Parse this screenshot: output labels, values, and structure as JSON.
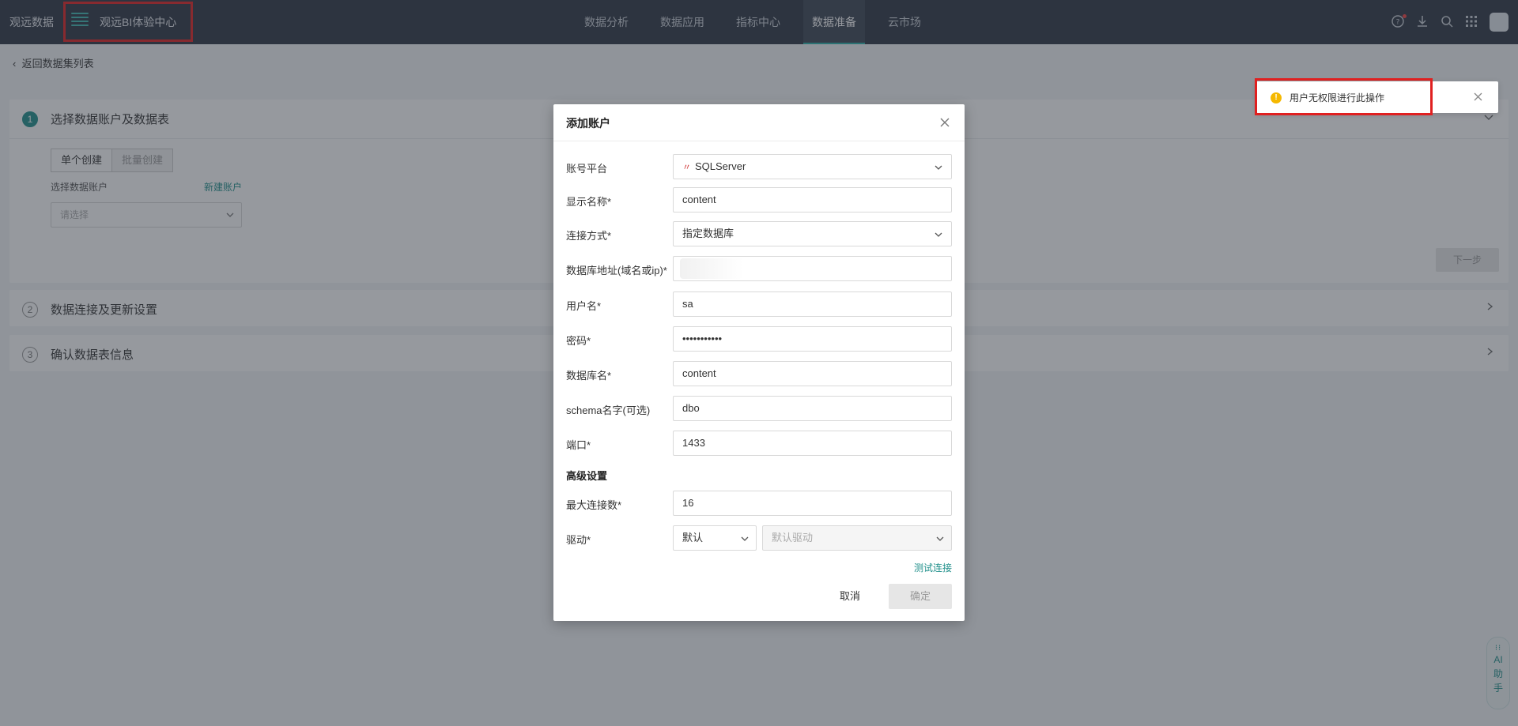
{
  "header": {
    "brand": "观远数据",
    "center_name": "观远BI体验中心",
    "nav": [
      {
        "label": "数据分析",
        "active": false
      },
      {
        "label": "数据应用",
        "active": false
      },
      {
        "label": "指标中心",
        "active": false
      },
      {
        "label": "数据准备",
        "active": true
      },
      {
        "label": "云市场",
        "active": false
      }
    ],
    "icons": [
      "help-icon",
      "download-icon",
      "search-icon",
      "apps-grid-icon",
      "avatar"
    ]
  },
  "page": {
    "back_label": "返回数据集列表",
    "steps": [
      {
        "number": "1",
        "title": "选择数据账户及数据表",
        "active": true
      },
      {
        "number": "2",
        "title": "数据连接及更新设置",
        "active": false
      },
      {
        "number": "3",
        "title": "确认数据表信息",
        "active": false
      }
    ],
    "mode_single": "单个创建",
    "mode_batch": "批量创建",
    "account_label": "选择数据账户",
    "new_account": "新建账户",
    "account_placeholder": "请选择",
    "next": "下一步"
  },
  "modal": {
    "title": "添加账户",
    "fields": {
      "platform": {
        "label": "账号平台",
        "value": "SQLServer"
      },
      "display_name": {
        "label": "显示名称*",
        "value": "content"
      },
      "connect_mode": {
        "label": "连接方式*",
        "value": "指定数据库"
      },
      "host": {
        "label": "数据库地址(域名或ip)*",
        "value": ""
      },
      "username": {
        "label": "用户名*",
        "value": "sa"
      },
      "password": {
        "label": "密码*",
        "value": "•••••••••••"
      },
      "db_name": {
        "label": "数据库名*",
        "value": "content"
      },
      "schema": {
        "label": "schema名字(可选)",
        "value": "dbo"
      },
      "port": {
        "label": "端口*",
        "value": "1433"
      }
    },
    "advanced_title": "高级设置",
    "max_conn": {
      "label": "最大连接数*",
      "value": "16"
    },
    "driver": {
      "label": "驱动*",
      "value": "默认",
      "driver_placeholder": "默认驱动"
    },
    "test_connection": "测试连接",
    "cancel": "取消",
    "confirm": "确定"
  },
  "toast": {
    "icon": "warning-icon",
    "message": "用户无权限进行此操作"
  },
  "ai_helper": {
    "label_ai": "AI",
    "label_zhu": "助",
    "label_shou": "手"
  },
  "colors": {
    "accent": "#1f8f8a",
    "topbar": "#2d3542",
    "highlight_border": "#e02020",
    "warning": "#f5b800"
  }
}
